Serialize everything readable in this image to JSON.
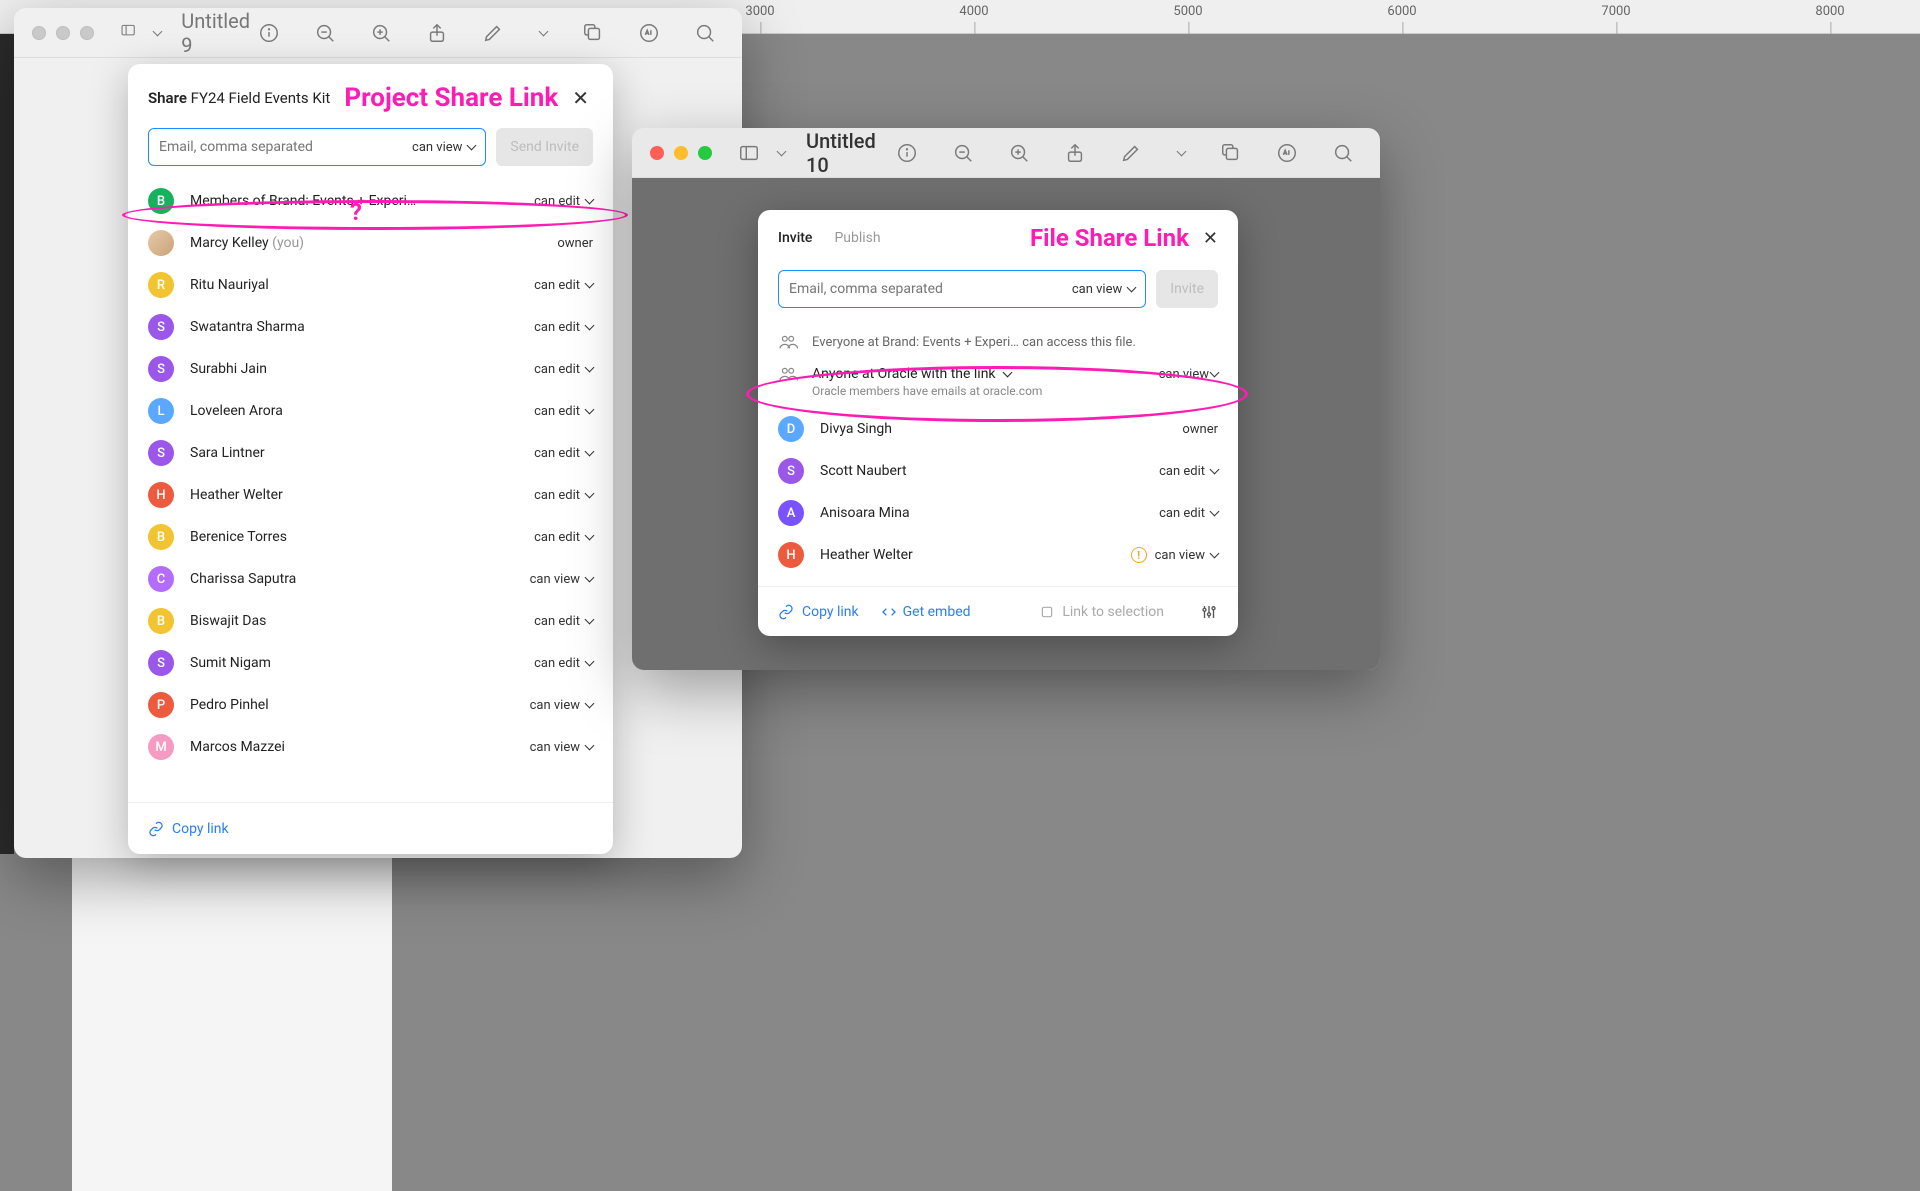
{
  "ruler": {
    "marks": [
      3000,
      4000,
      5000,
      6000,
      7000,
      8000
    ]
  },
  "win1": {
    "title": "Untitled 9",
    "share": {
      "prefix": "Share",
      "project": "FY24 Field Events Kit",
      "annotation": "Project Share Link",
      "placeholder": "Email, comma separated",
      "perm": "can view",
      "invite_btn": "Send Invite",
      "copy_link": "Copy link",
      "question": "?",
      "members": [
        {
          "initial": "B",
          "color": "#18b25c",
          "name": "Members of Brand: Events + Experi…",
          "perm": "can edit"
        },
        {
          "initial": "",
          "color": "#d7b38c",
          "name": "Marcy Kelley",
          "you": "(you)",
          "perm": "owner",
          "avatar_img": true
        },
        {
          "initial": "R",
          "color": "#f2c431",
          "name": "Ritu Nauriyal",
          "perm": "can edit"
        },
        {
          "initial": "S",
          "color": "#9a57e9",
          "name": "Swatantra Sharma",
          "perm": "can edit"
        },
        {
          "initial": "S",
          "color": "#9a57e9",
          "name": "Surabhi Jain",
          "perm": "can edit"
        },
        {
          "initial": "L",
          "color": "#5aa8ff",
          "name": "Loveleen Arora",
          "perm": "can edit"
        },
        {
          "initial": "S",
          "color": "#9a57e9",
          "name": "Sara Lintner",
          "perm": "can edit"
        },
        {
          "initial": "H",
          "color": "#ee5a3e",
          "name": "Heather Welter",
          "perm": "can edit"
        },
        {
          "initial": "B",
          "color": "#f2c431",
          "name": "Berenice Torres",
          "perm": "can edit"
        },
        {
          "initial": "C",
          "color": "#b46cff",
          "name": "Charissa Saputra",
          "perm": "can view"
        },
        {
          "initial": "B",
          "color": "#f2c431",
          "name": "Biswajit Das",
          "perm": "can edit"
        },
        {
          "initial": "S",
          "color": "#9a57e9",
          "name": "Sumit Nigam",
          "perm": "can edit"
        },
        {
          "initial": "P",
          "color": "#ee5a3e",
          "name": "Pedro Pinhel",
          "perm": "can view"
        },
        {
          "initial": "M",
          "color": "#f59bc2",
          "name": "Marcos Mazzei",
          "perm": "can view"
        }
      ]
    }
  },
  "win2": {
    "title": "Untitled 10",
    "share": {
      "tabs": {
        "invite": "Invite",
        "publish": "Publish"
      },
      "annotation": "File Share Link",
      "placeholder": "Email, comma separated",
      "perm": "can view",
      "invite_btn": "Invite",
      "everyone_text": "Everyone at Brand: Events + Experi… can access this file.",
      "link_scope": "Anyone at Oracle with the link",
      "link_perm": "can view",
      "link_sub": "Oracle members have emails at oracle.com",
      "members": [
        {
          "initial": "D",
          "color": "#5aa8ff",
          "name": "Divya Singh",
          "perm": "owner"
        },
        {
          "initial": "S",
          "color": "#9a57e9",
          "name": "Scott Naubert",
          "perm": "can edit"
        },
        {
          "initial": "A",
          "color": "#7a52ff",
          "name": "Anisoara Mina",
          "perm": "can edit"
        },
        {
          "initial": "H",
          "color": "#ee5a3e",
          "name": "Heather Welter",
          "perm": "can view",
          "warn": true
        }
      ],
      "copy_link": "Copy link",
      "get_embed": "Get embed",
      "link_to_selection": "Link to selection"
    }
  }
}
